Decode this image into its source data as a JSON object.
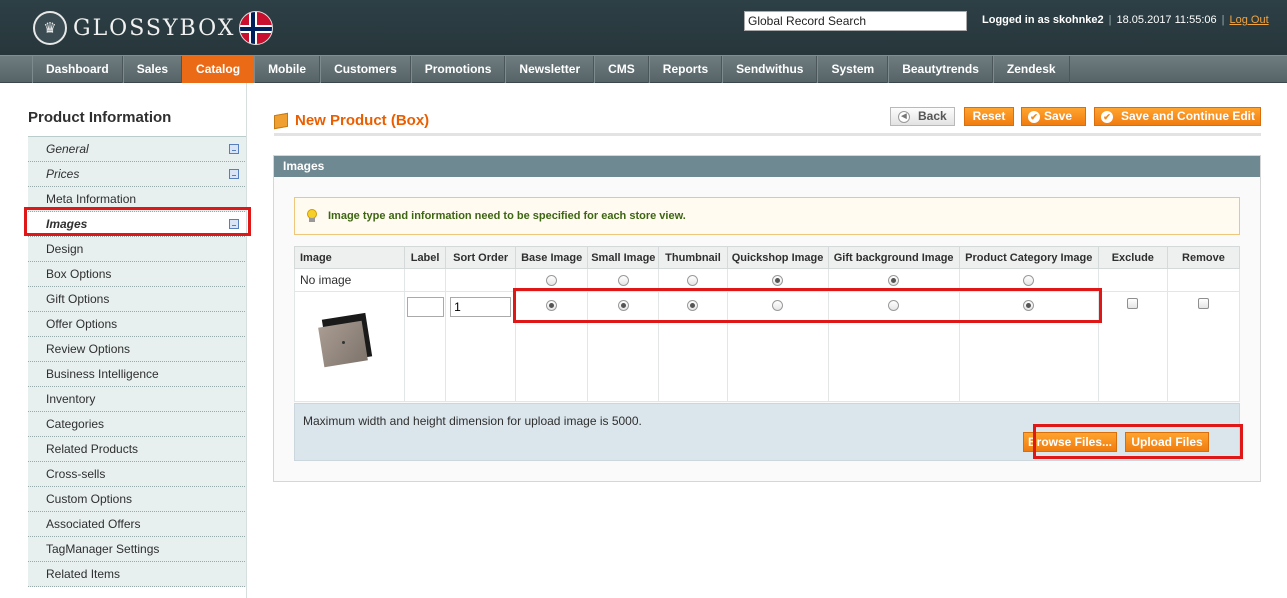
{
  "header": {
    "logo_text": "GLOSSYBOX",
    "search_placeholder": "Global Record Search",
    "logged_in": "Logged in as skohnke2",
    "timestamp": "18.05.2017 11:55:06",
    "logout": "Log Out"
  },
  "nav": [
    "Dashboard",
    "Sales",
    "Catalog",
    "Mobile",
    "Customers",
    "Promotions",
    "Newsletter",
    "CMS",
    "Reports",
    "Sendwithus",
    "System",
    "Beautytrends",
    "Zendesk"
  ],
  "nav_active": "Catalog",
  "sidebar": {
    "title": "Product Information",
    "tabs": [
      {
        "label": "General",
        "style": "italic",
        "saved": true
      },
      {
        "label": "Prices",
        "style": "italic",
        "saved": true
      },
      {
        "label": "Meta Information"
      },
      {
        "label": "Images",
        "style": "active",
        "saved": true
      },
      {
        "label": "Design"
      },
      {
        "label": "Box Options"
      },
      {
        "label": "Gift Options"
      },
      {
        "label": "Offer Options"
      },
      {
        "label": "Review Options"
      },
      {
        "label": "Business Intelligence"
      },
      {
        "label": "Inventory"
      },
      {
        "label": "Categories"
      },
      {
        "label": "Related Products"
      },
      {
        "label": "Cross-sells"
      },
      {
        "label": "Custom Options"
      },
      {
        "label": "Associated Offers"
      },
      {
        "label": "TagManager Settings"
      },
      {
        "label": "Related Items"
      }
    ]
  },
  "page": {
    "title": "New Product (Box)",
    "buttons": {
      "back": "Back",
      "reset": "Reset",
      "save": "Save",
      "save_continue": "Save and Continue Edit"
    }
  },
  "images_section": {
    "heading": "Images",
    "notice": "Image type and information need to be specified for each store view.",
    "columns": [
      "Image",
      "Label",
      "Sort Order",
      "Base Image",
      "Small Image",
      "Thumbnail",
      "Quickshop Image",
      "Gift background Image",
      "Product Category Image",
      "Exclude",
      "Remove"
    ],
    "no_image_label": "No image",
    "no_image_row": {
      "base": false,
      "small": false,
      "thumbnail": false,
      "quickshop": true,
      "gift": true,
      "category": false
    },
    "image_row": {
      "label": "",
      "sort_order": "1",
      "base": true,
      "small": true,
      "thumbnail": true,
      "quickshop": false,
      "gift": false,
      "category": true,
      "exclude": false,
      "remove": false
    },
    "upload_note": "Maximum width and height dimension for upload image is 5000.",
    "browse_button": "Browse Files...",
    "upload_button": "Upload Files"
  },
  "colors": {
    "accent": "#eb6a16",
    "header": "#2c3e43",
    "section_head": "#6f8992",
    "highlight": "#e01717"
  }
}
